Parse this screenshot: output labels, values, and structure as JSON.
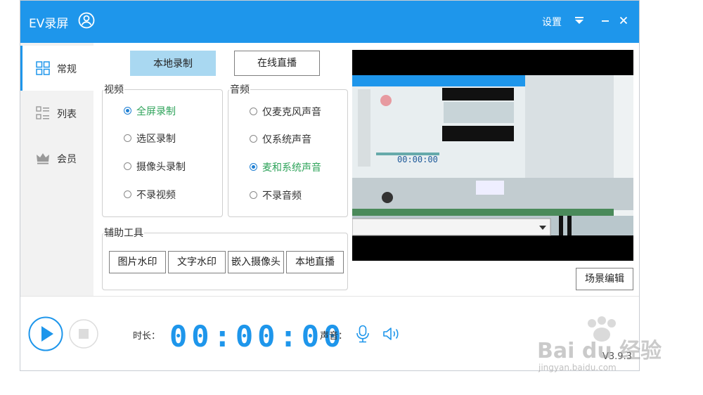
{
  "app": {
    "title": "EV录屏",
    "version": "V3.9.3"
  },
  "titlebar": {
    "settings_label": "设置"
  },
  "sidebar": {
    "items": [
      {
        "label": "常规",
        "icon": "grid-icon",
        "active": true
      },
      {
        "label": "列表",
        "icon": "list-icon",
        "active": false
      },
      {
        "label": "会员",
        "icon": "crown-icon",
        "active": false
      }
    ]
  },
  "mode_tabs": {
    "local": "本地录制",
    "live": "在线直播"
  },
  "video": {
    "group_label": "视频",
    "options": [
      "全屏录制",
      "选区录制",
      "摄像头录制",
      "不录视频"
    ],
    "selected": "全屏录制"
  },
  "audio": {
    "group_label": "音频",
    "options": [
      "仅麦克风声音",
      "仅系统声音",
      "麦和系统声音",
      "不录音频"
    ],
    "selected": "麦和系统声音"
  },
  "tools": {
    "group_label": "辅助工具",
    "buttons": [
      "图片水印",
      "文字水印",
      "嵌入摄像头",
      "本地直播"
    ]
  },
  "preview": {
    "scene_edit_label": "场景编辑"
  },
  "bottom": {
    "duration_label": "时长：",
    "duration_value": "00:00:00",
    "sound_label": "声音："
  },
  "watermark": {
    "brand": "Bai du 经验",
    "url": "jingyan.baidu.com"
  },
  "colors": {
    "accent": "#1e96eb",
    "selected_text": "#2ea35a",
    "primary_button": "#a9d8f1"
  }
}
